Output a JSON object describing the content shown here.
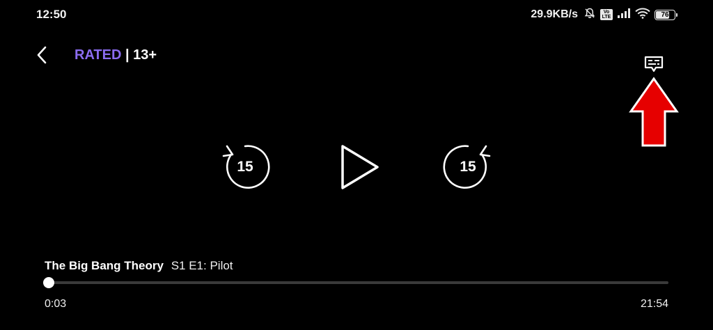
{
  "status_bar": {
    "time": "12:50",
    "net_speed": "29.9KB/s",
    "volte_label": "Vo\nLTE",
    "battery_level": "76",
    "battery_fraction": 0.76
  },
  "header": {
    "rated_label": "RATED",
    "separator": "|",
    "age_rating": "13+"
  },
  "controls": {
    "rewind_seconds": "15",
    "forward_seconds": "15"
  },
  "media": {
    "show_title": "The Big Bang Theory",
    "episode": "S1 E1: Pilot",
    "elapsed": "0:03",
    "duration": "21:54",
    "progress_fraction": 0.0023
  },
  "colors": {
    "background": "#000000",
    "rated_accent": "#8b6cf0",
    "annotation_arrow": "#e60000"
  },
  "icons": {
    "back": "chevron-left-icon",
    "subtitles": "subtitles-icon",
    "rewind": "rewind-15-icon",
    "play": "play-icon",
    "forward": "forward-15-icon",
    "annotation": "red-arrow-up-icon"
  }
}
